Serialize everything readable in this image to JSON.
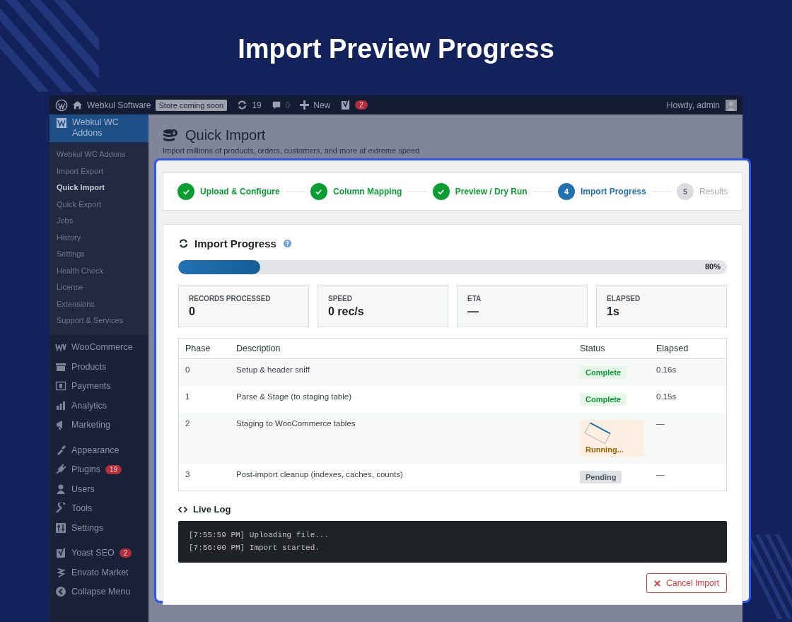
{
  "headline": "Import Preview Progress",
  "admin_bar": {
    "site": "Webkul Software",
    "site_badge": "Store coming soon",
    "updates": "19",
    "comments": "0",
    "new": "New",
    "seo_badge": "2",
    "greeting": "Howdy, admin"
  },
  "sidebar": {
    "header": "Webkul WC Addons",
    "submenu": [
      {
        "label": "Webkul WC Addons",
        "selected": false
      },
      {
        "label": "Import Export",
        "selected": false
      },
      {
        "label": "Quick Import",
        "selected": true
      },
      {
        "label": "Quick Export",
        "selected": false
      },
      {
        "label": "Jobs",
        "selected": false
      },
      {
        "label": "History",
        "selected": false
      },
      {
        "label": "Settings",
        "selected": false
      },
      {
        "label": "Health Check",
        "selected": false
      },
      {
        "label": "License",
        "selected": false
      },
      {
        "label": "Extensions",
        "selected": false
      },
      {
        "label": "Support & Services",
        "selected": false
      }
    ],
    "groups": [
      [
        {
          "label": "WooCommerce"
        },
        {
          "label": "Products"
        },
        {
          "label": "Payments"
        },
        {
          "label": "Analytics"
        },
        {
          "label": "Marketing"
        }
      ],
      [
        {
          "label": "Appearance"
        },
        {
          "label": "Plugins",
          "badge": "19"
        },
        {
          "label": "Users"
        },
        {
          "label": "Tools"
        },
        {
          "label": "Settings"
        }
      ],
      [
        {
          "label": "Yoast SEO",
          "badge": "2"
        },
        {
          "label": "Envato Market"
        },
        {
          "label": "Collapse Menu"
        }
      ]
    ]
  },
  "page": {
    "title": "Quick Import",
    "subtitle": "Import millions of products, orders, customers, and more at extreme speed"
  },
  "steps": [
    {
      "label": "Upload & Configure",
      "completed": true,
      "selected": false
    },
    {
      "label": "Column Mapping",
      "completed": true,
      "selected": false
    },
    {
      "label": "Preview / Dry Run",
      "completed": true,
      "selected": false
    },
    {
      "number": "4",
      "label": "Import Progress",
      "completed": false,
      "selected": true
    },
    {
      "number": "5",
      "label": "Results",
      "completed": false,
      "selected": false
    }
  ],
  "progress": {
    "title": "Import Progress",
    "level": 0.15,
    "percent": "80%"
  },
  "stats": [
    {
      "label": "RECORDS PROCESSED",
      "value": "0"
    },
    {
      "label": "SPEED",
      "value": "0 rec/s"
    },
    {
      "label": "ETA",
      "value": "—"
    },
    {
      "label": "ELAPSED",
      "value": "1s"
    }
  ],
  "table": {
    "columns": [
      "Phase",
      "Description",
      "Status",
      "Elapsed"
    ],
    "rows": [
      {
        "phase": "0",
        "description": "Setup & header sniff",
        "status": "Complete",
        "kind": "complete",
        "elapsed": "0.16s"
      },
      {
        "phase": "1",
        "description": "Parse & Stage (to staging table)",
        "status": "Complete",
        "kind": "complete",
        "elapsed": "0.15s"
      },
      {
        "phase": "2",
        "description": "Staging to WooCommerce tables",
        "status": "Running...",
        "kind": "running",
        "elapsed": "—"
      },
      {
        "phase": "3",
        "description": "Post-import cleanup (indexes, caches, counts)",
        "status": "Pending",
        "kind": "pending",
        "elapsed": "—"
      }
    ]
  },
  "live_log": {
    "title": "Live Log",
    "lines": [
      "[7:55:59 PM] Uploading file...",
      "[7:56:00 PM] Import started."
    ]
  },
  "cancel_button": "Cancel Import"
}
